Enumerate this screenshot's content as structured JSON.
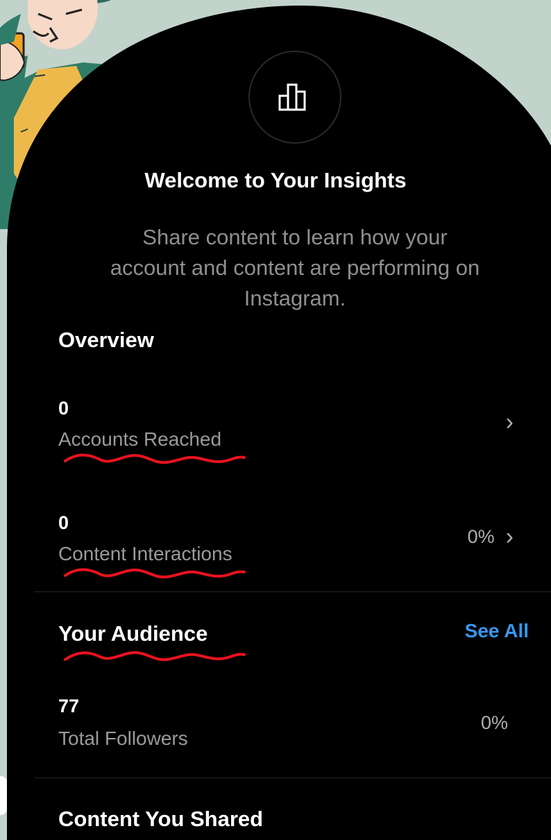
{
  "header": {
    "icon": "bar-chart-icon",
    "title": "Welcome to Your Insights",
    "subtitle_lines": [
      "Share content to learn how your",
      "account and content are performing on",
      "Instagram."
    ]
  },
  "overview": {
    "heading": "Overview",
    "metrics": [
      {
        "value": "0",
        "label": "Accounts Reached"
      },
      {
        "value": "0",
        "label": "Content Interactions",
        "change": "0%"
      }
    ]
  },
  "audience": {
    "heading": "Your Audience",
    "see_all": "See All",
    "metrics": [
      {
        "value": "77",
        "label": "Total Followers",
        "change": "0%"
      }
    ]
  },
  "content_shared": {
    "heading": "Content You Shared"
  },
  "colors": {
    "background": "#c2d3cb",
    "panel": "#000000",
    "link": "#3797f0",
    "annotation": "#e8121e"
  }
}
